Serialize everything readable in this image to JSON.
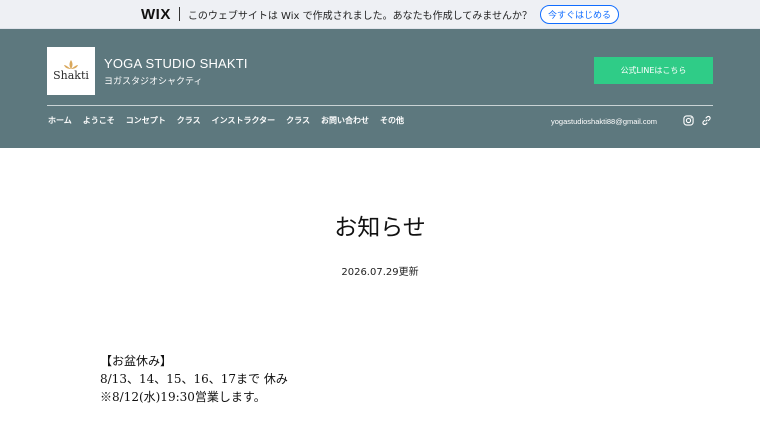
{
  "wix_banner": {
    "logo": "WIX",
    "text": "このウェブサイトは Wix で作成されました。あなたも作成してみませんか？",
    "cta": "今すぐはじめる"
  },
  "header": {
    "logo_word": "Shakti",
    "site_title": "YOGA STUDIO SHAKTI",
    "site_subtitle": "ヨガスタジオシャクティ",
    "line_button": "公式LINEはこちら",
    "email": "yogastudioshakti88@gmail.com",
    "icons": [
      "instagram-icon",
      "link-icon"
    ]
  },
  "nav": {
    "items": [
      "ホーム",
      "ようこそ",
      "コンセプト",
      "クラス",
      "インストラクター",
      "クラス",
      "お問い合わせ",
      "その他"
    ]
  },
  "main": {
    "title": "お知らせ",
    "updated": "2026.07.29更新",
    "notice_lines": [
      "【お盆休み】",
      "8/13、14、15、16、17まで 休み",
      "※8/12(水)19:30営業します。"
    ]
  },
  "colors": {
    "header_bg": "#5d787e",
    "line_button": "#2fcc87",
    "wix_accent": "#116dff"
  }
}
